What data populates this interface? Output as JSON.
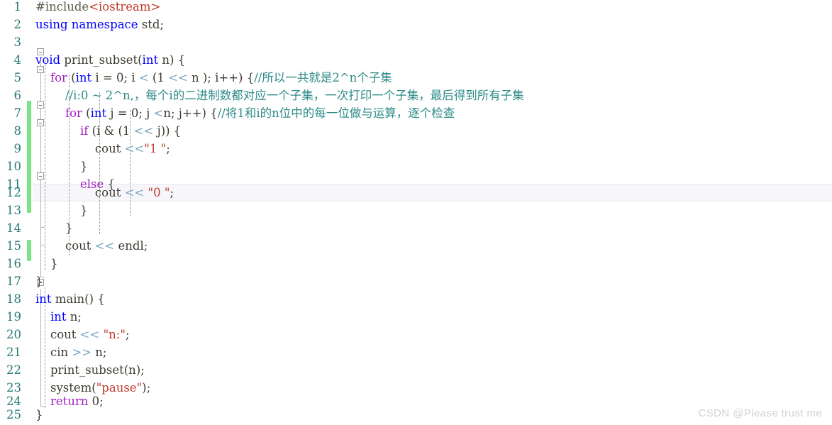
{
  "editor": {
    "language": "cpp",
    "first_line": 1,
    "last_line": 25,
    "current_line": 12,
    "colors": {
      "background": "#ffffff",
      "line_number": "#2b7a78",
      "keyword": "#0000ff",
      "control_keyword": "#a020c0",
      "string": "#c0392b",
      "comment": "#2e8b88",
      "operator": "#7aa6c2",
      "plain_text": "#3c3c32",
      "change_bar": "#7ae582",
      "current_line_highlight": "#f7f7fb",
      "indent_guide": "#9a9a9a",
      "watermark": "#d2d2d2"
    },
    "change_bars": [
      {
        "from_line": 7,
        "to_line": 13
      },
      {
        "from_line": 15,
        "to_line": 15
      }
    ],
    "fold_markers": [
      {
        "line": 4,
        "state": "expanded"
      },
      {
        "line": 5,
        "state": "expanded"
      },
      {
        "line": 7,
        "state": "expanded"
      },
      {
        "line": 8,
        "state": "expanded"
      },
      {
        "line": 11,
        "state": "expanded"
      },
      {
        "line": 18,
        "state": "expanded"
      }
    ],
    "line_numbers": [
      1,
      2,
      3,
      4,
      5,
      6,
      7,
      8,
      9,
      10,
      11,
      12,
      13,
      14,
      15,
      16,
      17,
      18,
      19,
      20,
      21,
      22,
      23,
      24,
      25
    ],
    "lines": [
      {
        "n": 1,
        "text": "#include<iostream>"
      },
      {
        "n": 2,
        "text": "using namespace std;"
      },
      {
        "n": 3,
        "text": ""
      },
      {
        "n": 4,
        "text": "void print_subset(int n) {"
      },
      {
        "n": 5,
        "text": "    for (int i = 0; i < (1 << n ); i++) {//所以一共就是2^n个子集"
      },
      {
        "n": 6,
        "text": "        //i:0 ~ 2^n,，每个i的二进制数都对应一个子集，一次打印一个子集，最后得到所有子集"
      },
      {
        "n": 7,
        "text": "        for (int j = 0; j <n; j++) {//将1和i的n位中的每一位做与运算，逐个检查"
      },
      {
        "n": 8,
        "text": "            if (i & (1 << j)) {"
      },
      {
        "n": 9,
        "text": "                cout <<\"1 \";"
      },
      {
        "n": 10,
        "text": "            }"
      },
      {
        "n": 11,
        "text": "            else {"
      },
      {
        "n": 12,
        "text": "                cout << \"0 \";"
      },
      {
        "n": 13,
        "text": "            }"
      },
      {
        "n": 14,
        "text": "        }"
      },
      {
        "n": 15,
        "text": "        cout << endl;"
      },
      {
        "n": 16,
        "text": "    }"
      },
      {
        "n": 17,
        "text": "}"
      },
      {
        "n": 18,
        "text": "int main() {"
      },
      {
        "n": 19,
        "text": "    int n;"
      },
      {
        "n": 20,
        "text": "    cout << \"n:\";"
      },
      {
        "n": 21,
        "text": "    cin >> n;"
      },
      {
        "n": 22,
        "text": "    print_subset(n);"
      },
      {
        "n": 23,
        "text": "    system(\"pause\");"
      },
      {
        "n": 24,
        "text": "    return 0;"
      },
      {
        "n": 25,
        "text": "}"
      }
    ]
  },
  "watermark": {
    "text": "CSDN @Please trust me"
  }
}
